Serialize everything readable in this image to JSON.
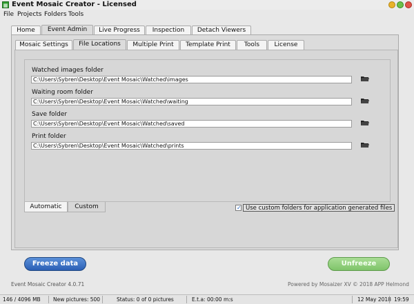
{
  "window": {
    "title": "Event Mosaic Creator - Licensed",
    "icon": "app-mosaic-icon",
    "controls": {
      "minimize": "minimize-icon",
      "maximize": "maximize-icon",
      "close": "close-icon"
    }
  },
  "menu": [
    "File",
    "Projects",
    "Folders",
    "Tools"
  ],
  "main_tabs": [
    {
      "label": "Home",
      "active": false
    },
    {
      "label": "Event Admin",
      "active": true
    },
    {
      "label": "Live Progress",
      "active": false
    },
    {
      "label": "Inspection",
      "active": false
    },
    {
      "label": "Detach Viewers",
      "active": false
    }
  ],
  "sub_tabs": [
    {
      "label": "Mosaic Settings",
      "active": false
    },
    {
      "label": "File Locations",
      "active": true
    },
    {
      "label": "Multiple Print",
      "active": false
    },
    {
      "label": "Template Print",
      "active": false
    },
    {
      "label": "Tools",
      "active": false
    },
    {
      "label": "License",
      "active": false
    }
  ],
  "folders": [
    {
      "label": "Watched images folder",
      "value": "C:\\Users\\Sybren\\Desktop\\Event Mosaic\\Watched\\images",
      "button_icon": "folder-open-icon"
    },
    {
      "label": "Waiting room folder",
      "value": "C:\\Users\\Sybren\\Desktop\\Event Mosaic\\Watched\\waiting",
      "button_icon": "folder-open-icon"
    },
    {
      "label": "Save folder",
      "value": "C:\\Users\\Sybren\\Desktop\\Event Mosaic\\Watched\\saved",
      "button_icon": "folder-open-icon"
    },
    {
      "label": "Print folder",
      "value": "C:\\Users\\Sybren\\Desktop\\Event Mosaic\\Watched\\prints",
      "button_icon": "folder-open-icon"
    }
  ],
  "mode_tabs": [
    {
      "label": "Automatic",
      "active": true
    },
    {
      "label": "Custom",
      "active": false
    }
  ],
  "custom_folders_checkbox": {
    "label": "Use custom folders for application generated files",
    "checked": true
  },
  "buttons": {
    "freeze": "Freeze data",
    "unfreeze": "Unfreeze"
  },
  "footer": {
    "version": "Event Mosaic Creator 4.0.71",
    "powered": "Powered by Mosaizer XV © 2018  APP Helmond"
  },
  "status": {
    "memory": "146 / 4096 MB",
    "new_pictures": "New pictures: 500",
    "status": "Status: 0 of 0 pictures",
    "eta": "E.t.a: 00:00 m:s",
    "date": "12 May 2018",
    "time": "19:59"
  },
  "colors": {
    "freeze_button": "#2b5fb5",
    "unfreeze_button": "#7fc46a",
    "checkbox_mark": "#1c5fbf"
  }
}
